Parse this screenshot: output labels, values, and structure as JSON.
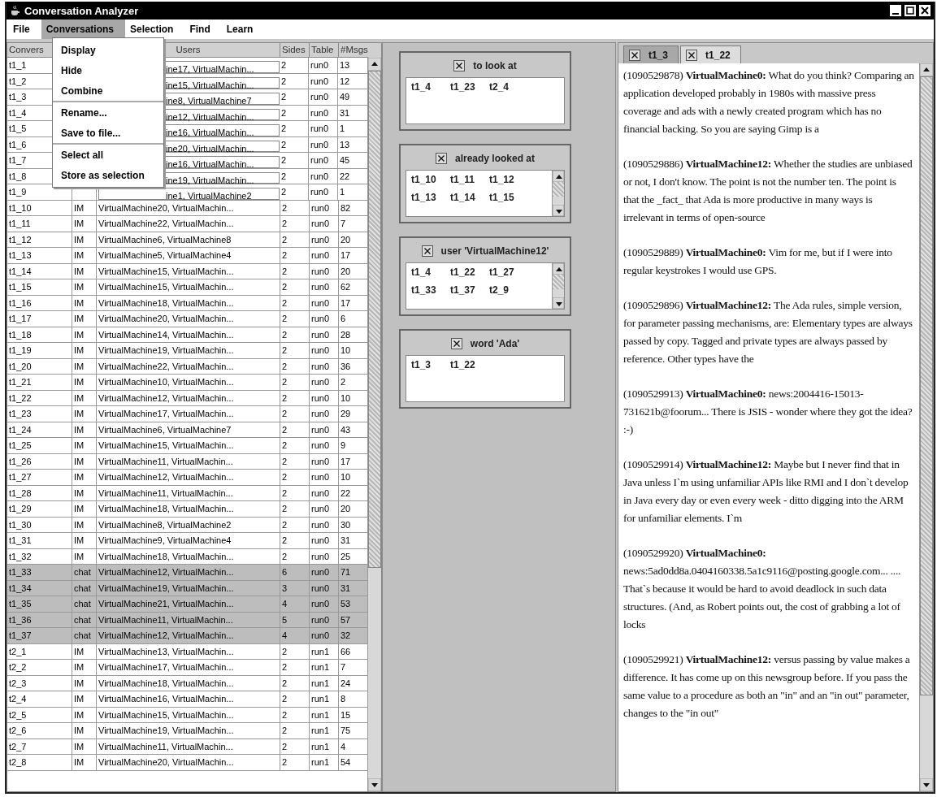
{
  "window": {
    "title": "Conversation Analyzer"
  },
  "menu_bar": {
    "items": [
      {
        "label": "File",
        "selected": false
      },
      {
        "label": "Conversations",
        "selected": true
      },
      {
        "label": "Selection",
        "selected": false
      },
      {
        "label": "Find",
        "selected": false
      },
      {
        "label": "Learn",
        "selected": false
      }
    ],
    "open_menu": {
      "groups": [
        [
          "Display",
          "Hide",
          "Combine"
        ],
        [
          "Rename...",
          "Save to file..."
        ],
        [
          "Select all",
          "Store as selection"
        ]
      ]
    }
  },
  "table": {
    "columns": {
      "conversation": "Convers",
      "users": "Users",
      "sides": "Sides",
      "table": "Table",
      "msgs": "#Msgs"
    },
    "rows": [
      {
        "conversation": "t1_1",
        "users": "ine17, VirtualMachin...",
        "sides": "2",
        "table": "run0",
        "msgs": "13",
        "selected": false
      },
      {
        "conversation": "t1_2",
        "users": "ine15, VirtualMachin...",
        "sides": "2",
        "table": "run0",
        "msgs": "12",
        "selected": false
      },
      {
        "conversation": "t1_3",
        "users": "ine8, VirtualMachine7",
        "sides": "2",
        "table": "run0",
        "msgs": "49",
        "selected": false
      },
      {
        "conversation": "t1_4",
        "users": "ine12, VirtualMachin...",
        "sides": "2",
        "table": "run0",
        "msgs": "31",
        "selected": false
      },
      {
        "conversation": "t1_5",
        "users": "ine16, VirtualMachin...",
        "sides": "2",
        "table": "run0",
        "msgs": "1",
        "selected": false
      },
      {
        "conversation": "t1_6",
        "users": "ine20, VirtualMachin...",
        "sides": "2",
        "table": "run0",
        "msgs": "13",
        "selected": false
      },
      {
        "conversation": "t1_7",
        "users": "ine16, VirtualMachin...",
        "sides": "2",
        "table": "run0",
        "msgs": "45",
        "selected": false
      },
      {
        "conversation": "t1_8",
        "users": "ine19, VirtualMachin...",
        "sides": "2",
        "table": "run0",
        "msgs": "22",
        "selected": false
      },
      {
        "conversation": "t1_9",
        "users": "ine1, VirtualMachine2",
        "sides": "2",
        "table": "run0",
        "msgs": "1",
        "selected": false
      },
      {
        "conversation": "t1_10",
        "type": "IM",
        "users": "VirtualMachine20, VirtualMachin...",
        "sides": "2",
        "table": "run0",
        "msgs": "82",
        "selected": false
      },
      {
        "conversation": "t1_11",
        "type": "IM",
        "users": "VirtualMachine22, VirtualMachin...",
        "sides": "2",
        "table": "run0",
        "msgs": "7",
        "selected": false
      },
      {
        "conversation": "t1_12",
        "type": "IM",
        "users": "VirtualMachine6, VirtualMachine8",
        "sides": "2",
        "table": "run0",
        "msgs": "20",
        "selected": false
      },
      {
        "conversation": "t1_13",
        "type": "IM",
        "users": "VirtualMachine5, VirtualMachine4",
        "sides": "2",
        "table": "run0",
        "msgs": "17",
        "selected": false
      },
      {
        "conversation": "t1_14",
        "type": "IM",
        "users": "VirtualMachine15, VirtualMachin...",
        "sides": "2",
        "table": "run0",
        "msgs": "20",
        "selected": false
      },
      {
        "conversation": "t1_15",
        "type": "IM",
        "users": "VirtualMachine15, VirtualMachin...",
        "sides": "2",
        "table": "run0",
        "msgs": "62",
        "selected": false
      },
      {
        "conversation": "t1_16",
        "type": "IM",
        "users": "VirtualMachine18, VirtualMachin...",
        "sides": "2",
        "table": "run0",
        "msgs": "17",
        "selected": false
      },
      {
        "conversation": "t1_17",
        "type": "IM",
        "users": "VirtualMachine20, VirtualMachin...",
        "sides": "2",
        "table": "run0",
        "msgs": "6",
        "selected": false
      },
      {
        "conversation": "t1_18",
        "type": "IM",
        "users": "VirtualMachine14, VirtualMachin...",
        "sides": "2",
        "table": "run0",
        "msgs": "28",
        "selected": false
      },
      {
        "conversation": "t1_19",
        "type": "IM",
        "users": "VirtualMachine19, VirtualMachin...",
        "sides": "2",
        "table": "run0",
        "msgs": "10",
        "selected": false
      },
      {
        "conversation": "t1_20",
        "type": "IM",
        "users": "VirtualMachine22, VirtualMachin...",
        "sides": "2",
        "table": "run0",
        "msgs": "36",
        "selected": false
      },
      {
        "conversation": "t1_21",
        "type": "IM",
        "users": "VirtualMachine10, VirtualMachin...",
        "sides": "2",
        "table": "run0",
        "msgs": "2",
        "selected": false
      },
      {
        "conversation": "t1_22",
        "type": "IM",
        "users": "VirtualMachine12, VirtualMachin...",
        "sides": "2",
        "table": "run0",
        "msgs": "10",
        "selected": false
      },
      {
        "conversation": "t1_23",
        "type": "IM",
        "users": "VirtualMachine17, VirtualMachin...",
        "sides": "2",
        "table": "run0",
        "msgs": "29",
        "selected": false
      },
      {
        "conversation": "t1_24",
        "type": "IM",
        "users": "VirtualMachine6, VirtualMachine7",
        "sides": "2",
        "table": "run0",
        "msgs": "43",
        "selected": false
      },
      {
        "conversation": "t1_25",
        "type": "IM",
        "users": "VirtualMachine15, VirtualMachin...",
        "sides": "2",
        "table": "run0",
        "msgs": "9",
        "selected": false
      },
      {
        "conversation": "t1_26",
        "type": "IM",
        "users": "VirtualMachine11, VirtualMachin...",
        "sides": "2",
        "table": "run0",
        "msgs": "17",
        "selected": false
      },
      {
        "conversation": "t1_27",
        "type": "IM",
        "users": "VirtualMachine12, VirtualMachin...",
        "sides": "2",
        "table": "run0",
        "msgs": "10",
        "selected": false
      },
      {
        "conversation": "t1_28",
        "type": "IM",
        "users": "VirtualMachine11, VirtualMachin...",
        "sides": "2",
        "table": "run0",
        "msgs": "22",
        "selected": false
      },
      {
        "conversation": "t1_29",
        "type": "IM",
        "users": "VirtualMachine18, VirtualMachin...",
        "sides": "2",
        "table": "run0",
        "msgs": "20",
        "selected": false
      },
      {
        "conversation": "t1_30",
        "type": "IM",
        "users": "VirtualMachine8, VirtualMachine2",
        "sides": "2",
        "table": "run0",
        "msgs": "30",
        "selected": false
      },
      {
        "conversation": "t1_31",
        "type": "IM",
        "users": "VirtualMachine9, VirtualMachine4",
        "sides": "2",
        "table": "run0",
        "msgs": "31",
        "selected": false
      },
      {
        "conversation": "t1_32",
        "type": "IM",
        "users": "VirtualMachine18, VirtualMachin...",
        "sides": "2",
        "table": "run0",
        "msgs": "25",
        "selected": false
      },
      {
        "conversation": "t1_33",
        "type": "chat",
        "users": "VirtualMachine12, VirtualMachin...",
        "sides": "6",
        "table": "run0",
        "msgs": "71",
        "selected": true
      },
      {
        "conversation": "t1_34",
        "type": "chat",
        "users": "VirtualMachine19, VirtualMachin...",
        "sides": "3",
        "table": "run0",
        "msgs": "31",
        "selected": true
      },
      {
        "conversation": "t1_35",
        "type": "chat",
        "users": "VirtualMachine21, VirtualMachin...",
        "sides": "4",
        "table": "run0",
        "msgs": "53",
        "selected": true
      },
      {
        "conversation": "t1_36",
        "type": "chat",
        "users": "VirtualMachine11, VirtualMachin...",
        "sides": "5",
        "table": "run0",
        "msgs": "57",
        "selected": true
      },
      {
        "conversation": "t1_37",
        "type": "chat",
        "users": "VirtualMachine12, VirtualMachin...",
        "sides": "4",
        "table": "run0",
        "msgs": "32",
        "selected": true
      },
      {
        "conversation": "t2_1",
        "type": "IM",
        "users": "VirtualMachine13, VirtualMachin...",
        "sides": "2",
        "table": "run1",
        "msgs": "66",
        "selected": false
      },
      {
        "conversation": "t2_2",
        "type": "IM",
        "users": "VirtualMachine17, VirtualMachin...",
        "sides": "2",
        "table": "run1",
        "msgs": "7",
        "selected": false
      },
      {
        "conversation": "t2_3",
        "type": "IM",
        "users": "VirtualMachine18, VirtualMachin...",
        "sides": "2",
        "table": "run1",
        "msgs": "24",
        "selected": false
      },
      {
        "conversation": "t2_4",
        "type": "IM",
        "users": "VirtualMachine16, VirtualMachin...",
        "sides": "2",
        "table": "run1",
        "msgs": "8",
        "selected": false
      },
      {
        "conversation": "t2_5",
        "type": "IM",
        "users": "VirtualMachine15, VirtualMachin...",
        "sides": "2",
        "table": "run1",
        "msgs": "15",
        "selected": false
      },
      {
        "conversation": "t2_6",
        "type": "IM",
        "users": "VirtualMachine19, VirtualMachin...",
        "sides": "2",
        "table": "run1",
        "msgs": "75",
        "selected": false
      },
      {
        "conversation": "t2_7",
        "type": "IM",
        "users": "VirtualMachine11, VirtualMachin...",
        "sides": "2",
        "table": "run1",
        "msgs": "4",
        "selected": false
      },
      {
        "conversation": "t2_8",
        "type": "IM",
        "users": "VirtualMachine20, VirtualMachin...",
        "sides": "2",
        "table": "run1",
        "msgs": "54",
        "selected": false
      }
    ]
  },
  "selections": [
    {
      "title": "to look at",
      "items": [
        "t1_4",
        "t1_23",
        "t2_4"
      ],
      "scrollable": false
    },
    {
      "title": "already looked at",
      "items": [
        "t1_10",
        "t1_11",
        "t1_12",
        "t1_13",
        "t1_14",
        "t1_15"
      ],
      "scrollable": true
    },
    {
      "title": "user 'VirtualMachine12'",
      "items": [
        "t1_4",
        "t1_22",
        "t1_27",
        "t1_33",
        "t1_37",
        "t2_9"
      ],
      "scrollable": true
    },
    {
      "title": "word 'Ada'",
      "items": [
        "t1_3",
        "t1_22"
      ],
      "scrollable": false
    }
  ],
  "viewer": {
    "tabs": [
      {
        "label": "t1_3",
        "selected": true
      },
      {
        "label": "t1_22",
        "selected": false
      }
    ],
    "messages": [
      "(1090529878) **VirtualMachine0:** What do you think? Comparing an application developed probably in 1980s with massive press coverage and ads with a newly created program which has no financial backing. So you are saying Gimp is a",
      "(1090529886) **VirtualMachine12:** Whether the studies are unbiased or not, I don't know. The point is not the number ten. The point is that the _fact_ that Ada is more productive in many ways is irrelevant in terms of open-source",
      "(1090529889) **VirtualMachine0:** Vim for me, but if I were into regular keystrokes I would use GPS.",
      "(1090529896) **VirtualMachine12:** The Ada rules, simple version, for parameter passing mechanisms, are: Elementary types are always passed by copy. Tagged and private types are always passed by reference. Other types have the",
      "(1090529913) **VirtualMachine0:** news:2004416-15013-731621b@foorum... There is JSIS - wonder where they got the idea? :-)",
      "(1090529914) **VirtualMachine12:** Maybe but I never find that in Java unless I`m using unfamiliar APIs like RMI and I don`t develop in Java every day or even every week - ditto digging into the ARM for unfamiliar elements. I`m",
      "(1090529920) **VirtualMachine0:** news:5ad0dd8a.0404160338.5a1c9116@posting.google.com... .... That`s because it would be hard to avoid deadlock in such data structures. (And, as Robert points out, the cost of grabbing a lot of locks",
      "(1090529921) **VirtualMachine12:** versus passing by value makes a difference. It has come up on this newsgroup before. If you pass the same value to a procedure as both an \"in\" and an \"in out\" parameter, changes to the \"in out\""
    ]
  }
}
